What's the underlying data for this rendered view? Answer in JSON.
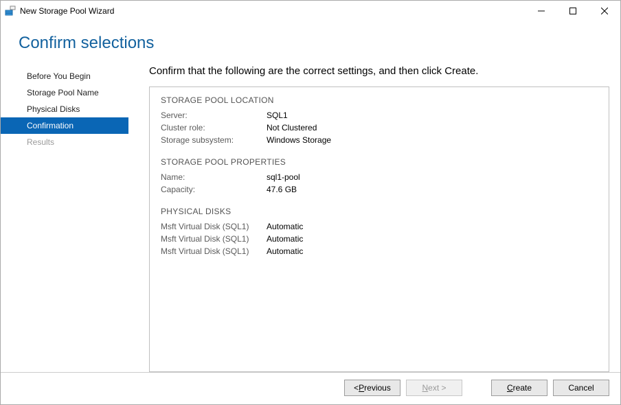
{
  "titlebar": {
    "title": "New Storage Pool Wizard"
  },
  "header": {
    "heading": "Confirm selections"
  },
  "sidebar": {
    "steps": {
      "0": {
        "label": "Before You Begin"
      },
      "1": {
        "label": "Storage Pool Name"
      },
      "2": {
        "label": "Physical Disks"
      },
      "3": {
        "label": "Confirmation"
      },
      "4": {
        "label": "Results"
      }
    }
  },
  "main": {
    "instruction": "Confirm that the following are the correct settings, and then click Create.",
    "sections": {
      "location": {
        "title": "STORAGE POOL LOCATION",
        "rows": {
          "server": {
            "k": "Server:",
            "v": "SQL1"
          },
          "role": {
            "k": "Cluster role:",
            "v": "Not Clustered"
          },
          "subsys": {
            "k": "Storage subsystem:",
            "v": "Windows Storage"
          }
        }
      },
      "properties": {
        "title": "STORAGE POOL PROPERTIES",
        "rows": {
          "name": {
            "k": "Name:",
            "v": "sql1-pool"
          },
          "capacity": {
            "k": "Capacity:",
            "v": "47.6 GB"
          }
        }
      },
      "disks": {
        "title": "PHYSICAL DISKS",
        "rows": {
          "0": {
            "k": "Msft Virtual Disk (SQL1)",
            "v": "Automatic"
          },
          "1": {
            "k": "Msft Virtual Disk (SQL1)",
            "v": "Automatic"
          },
          "2": {
            "k": "Msft Virtual Disk (SQL1)",
            "v": "Automatic"
          }
        }
      }
    }
  },
  "footer": {
    "prev_left": "< ",
    "prev_u": "P",
    "prev_rest": "revious",
    "next_u": "N",
    "next_rest": "ext >",
    "create_u": "C",
    "create_rest": "reate",
    "cancel_label": "Cancel"
  }
}
